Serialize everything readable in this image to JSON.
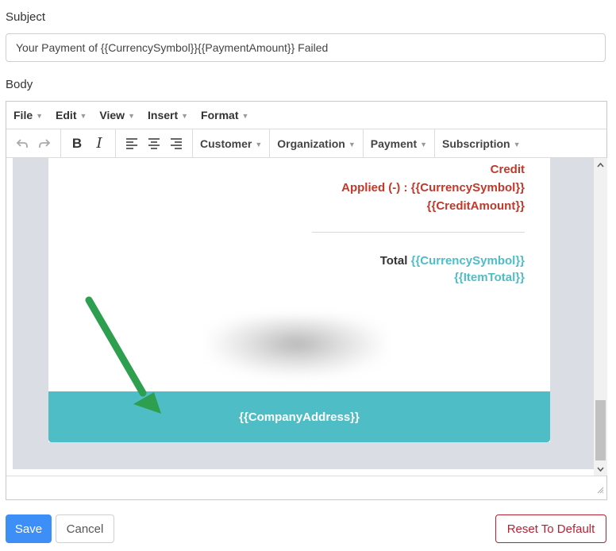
{
  "subject": {
    "label": "Subject",
    "value": "Your Payment of {{CurrencySymbol}}{{PaymentAmount}} Failed"
  },
  "body": {
    "label": "Body"
  },
  "menubar": {
    "items": [
      "File",
      "Edit",
      "View",
      "Insert",
      "Format"
    ]
  },
  "toolbar": {
    "icons": [
      "undo-icon",
      "redo-icon",
      "bold-icon",
      "italic-icon",
      "align-left-icon",
      "align-center-icon",
      "align-right-icon"
    ],
    "dropdowns": [
      "Customer",
      "Organization",
      "Payment",
      "Subscription"
    ]
  },
  "email": {
    "credit_line1": "Credit",
    "credit_line2": "Applied (-) : {{CurrencySymbol}}",
    "credit_line3": "{{CreditAmount}}",
    "total_label": "Total",
    "total_symbol": "{{CurrencySymbol}}",
    "total_value": "{{ItemTotal}}",
    "footer_text": "{{CompanyAddress}}"
  },
  "colors": {
    "accent_teal": "#4fbdc6",
    "credit_red": "#c0392b",
    "primary_blue": "#3e8ef7",
    "danger_red": "#b42335",
    "annotation_green": "#2e9e4f"
  },
  "buttons": {
    "save": "Save",
    "cancel": "Cancel",
    "reset": "Reset To Default"
  }
}
